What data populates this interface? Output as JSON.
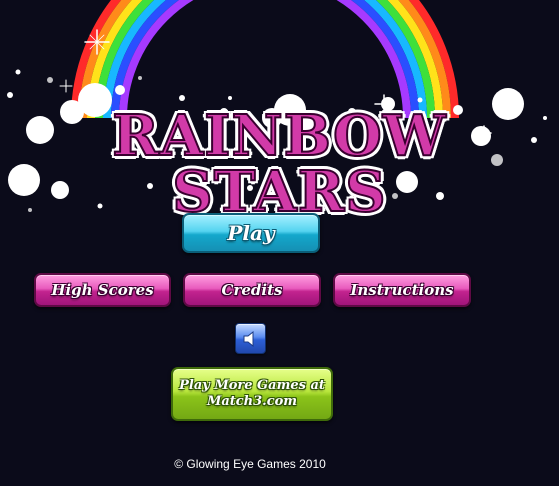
{
  "title": "RAINBOW STARS",
  "buttons": {
    "play": "Play",
    "high_scores": "High Scores",
    "credits": "Credits",
    "instructions": "Instructions",
    "more_games_line1": "Play More Games at",
    "more_games_line2": "Match3.com"
  },
  "sound_icon": "speaker-icon",
  "copyright": "© Glowing Eye Games 2010",
  "colors": {
    "background": "#0b0b1a",
    "title_pink": "#d23aa8",
    "play_cyan": "#14a8cc",
    "menu_pink": "#c2238f",
    "more_green": "#8cc41a",
    "sound_blue": "#2d5fd6"
  }
}
